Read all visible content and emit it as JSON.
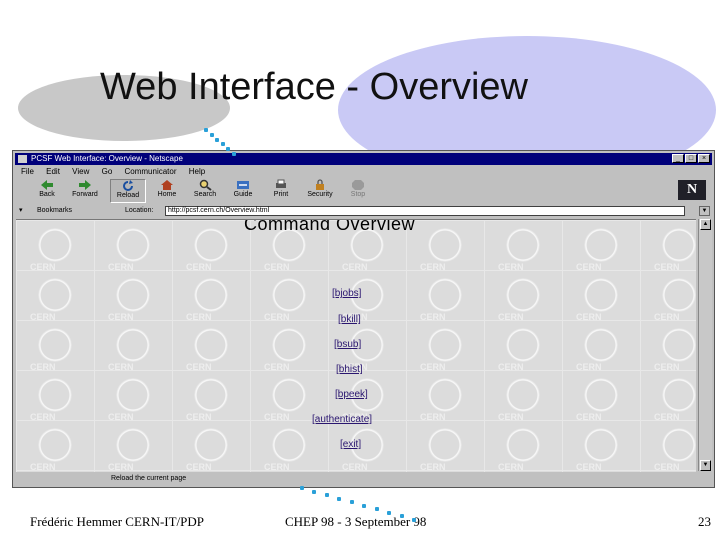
{
  "slide": {
    "title": "Web Interface - Overview",
    "footer_left": "Frédéric Hemmer CERN-IT/PDP",
    "footer_center": "CHEP 98 -  3 September 98",
    "footer_right": "23"
  },
  "browser": {
    "window_title": "PCSF Web Interface: Overview - Netscape",
    "menu": [
      "File",
      "Edit",
      "View",
      "Go",
      "Communicator",
      "Help"
    ],
    "toolbar": [
      {
        "label": "Back",
        "icon": "back-arrow-icon"
      },
      {
        "label": "Forward",
        "icon": "forward-arrow-icon"
      },
      {
        "label": "Reload",
        "icon": "reload-icon"
      },
      {
        "label": "Home",
        "icon": "home-icon"
      },
      {
        "label": "Search",
        "icon": "search-icon"
      },
      {
        "label": "Guide",
        "icon": "guide-icon"
      },
      {
        "label": "Print",
        "icon": "print-icon"
      },
      {
        "label": "Security",
        "icon": "security-icon"
      },
      {
        "label": "Stop",
        "icon": "stop-icon"
      }
    ],
    "bookmarks_label": "Bookmarks",
    "location_label": "Location:",
    "location_url": "http://pcsf.cern.ch/Overview.html",
    "status_text": "Reload the current page",
    "logo_letter": "N"
  },
  "page": {
    "heading": "Command Overview",
    "links": [
      "[bjobs]",
      "[bkill]",
      "[bsub]",
      "[bhist]",
      "[bpeek]",
      "[authenticate]",
      "[exit]"
    ],
    "watermark": "CERN"
  },
  "colors": {
    "title_bar": "#00007a",
    "link": "#2a1670",
    "ellipse_blue": "#c9c9f5",
    "ellipse_gray": "#c8c8c8",
    "dots": "#2aa0d8"
  }
}
